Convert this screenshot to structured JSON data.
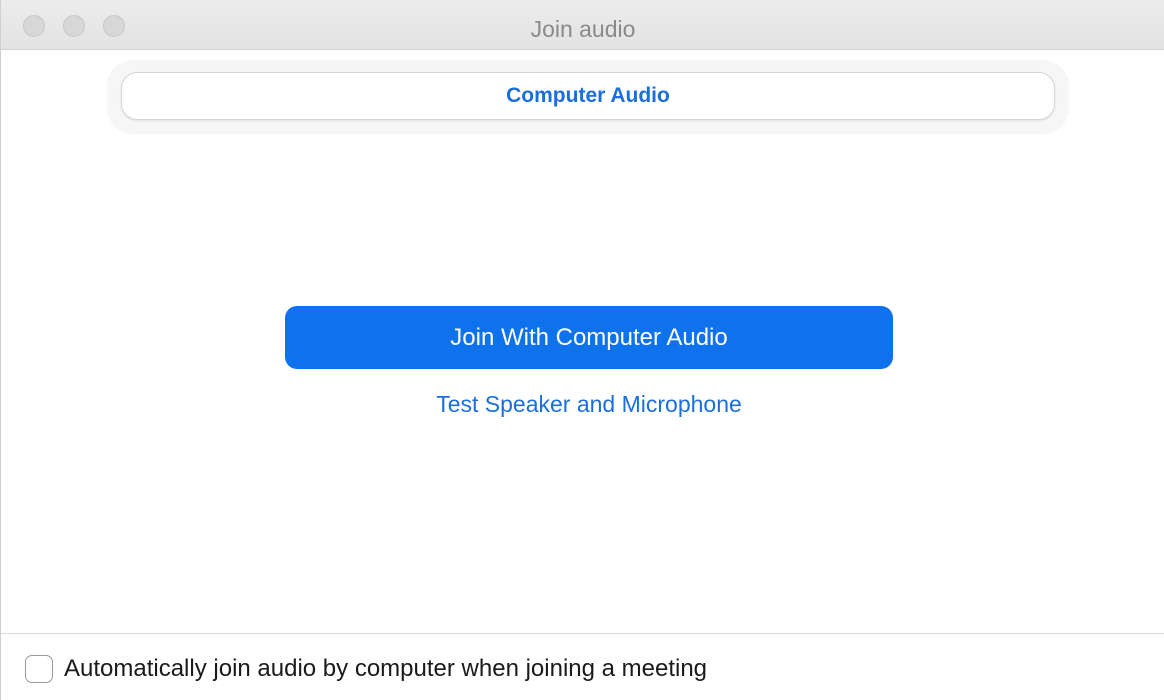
{
  "window": {
    "title": "Join audio"
  },
  "tabs": [
    {
      "label": "Computer Audio",
      "selected": true
    }
  ],
  "main": {
    "join_button_label": "Join With Computer Audio",
    "test_link_label": "Test Speaker and Microphone"
  },
  "footer": {
    "auto_join_label": "Automatically join audio by computer when joining a meeting",
    "auto_join_checked": false
  },
  "colors": {
    "accent": "#0e72ed",
    "link": "#1a6fdc",
    "titlebar": "#e8e8e8"
  }
}
